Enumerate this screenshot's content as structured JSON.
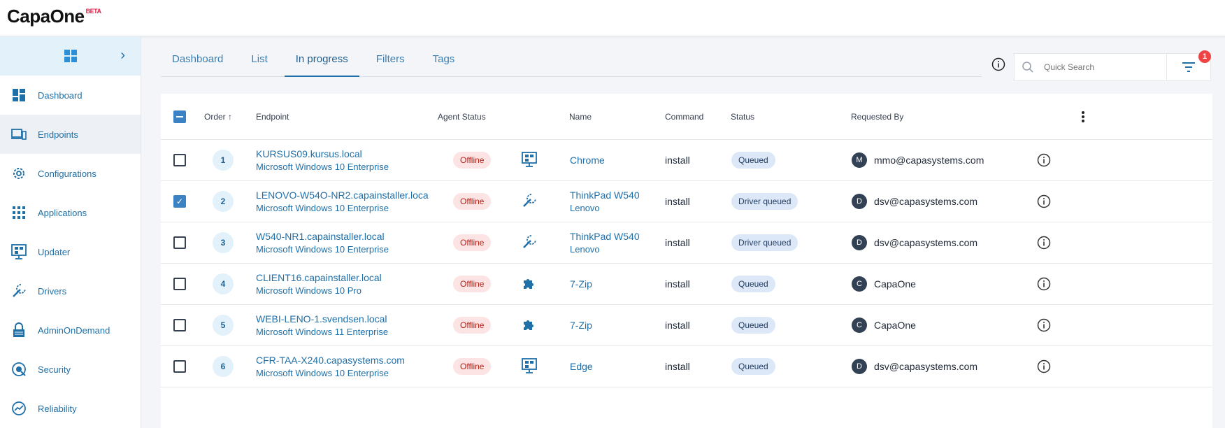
{
  "app": {
    "logo_text": "CapaOne",
    "logo_badge": "BETA"
  },
  "sidebar": {
    "items": [
      {
        "label": "Dashboard",
        "icon": "dashboard-icon"
      },
      {
        "label": "Endpoints",
        "icon": "endpoints-icon"
      },
      {
        "label": "Configurations",
        "icon": "gear-icon"
      },
      {
        "label": "Applications",
        "icon": "apps-grid-icon"
      },
      {
        "label": "Updater",
        "icon": "updater-icon"
      },
      {
        "label": "Drivers",
        "icon": "wrench-icon"
      },
      {
        "label": "AdminOnDemand",
        "icon": "lock-icon"
      },
      {
        "label": "Security",
        "icon": "security-icon"
      },
      {
        "label": "Reliability",
        "icon": "reliability-icon"
      }
    ]
  },
  "tabs": [
    {
      "label": "Dashboard"
    },
    {
      "label": "List"
    },
    {
      "label": "In progress"
    },
    {
      "label": "Filters"
    },
    {
      "label": "Tags"
    }
  ],
  "search": {
    "placeholder": "Quick Search"
  },
  "filter": {
    "badge_count": "1"
  },
  "table": {
    "headers": {
      "order": "Order ↑",
      "endpoint": "Endpoint",
      "agent_status": "Agent Status",
      "name": "Name",
      "command": "Command",
      "status": "Status",
      "requested_by": "Requested By"
    },
    "rows": [
      {
        "checked": false,
        "order": "1",
        "endpoint": "KURSUS09.kursus.local",
        "os": "Microsoft Windows 10 Enterprise",
        "agent_status": "Offline",
        "app_icon": "updater-icon",
        "name": "Chrome",
        "sub": "",
        "command": "install",
        "status": "Queued",
        "avatar": "M",
        "requested_by": "mmo@capasystems.com"
      },
      {
        "checked": true,
        "order": "2",
        "endpoint": "LENOVO-W54O-NR2.capainstaller.loca",
        "os": "Microsoft Windows 10 Enterprise",
        "agent_status": "Offline",
        "app_icon": "wrench-icon",
        "name": "ThinkPad W540",
        "sub": "Lenovo",
        "command": "install",
        "status": "Driver queued",
        "avatar": "D",
        "requested_by": "dsv@capasystems.com"
      },
      {
        "checked": false,
        "order": "3",
        "endpoint": "W540-NR1.capainstaller.local",
        "os": "Microsoft Windows 10 Enterprise",
        "agent_status": "Offline",
        "app_icon": "wrench-icon",
        "name": "ThinkPad W540",
        "sub": "Lenovo",
        "command": "install",
        "status": "Driver queued",
        "avatar": "D",
        "requested_by": "dsv@capasystems.com"
      },
      {
        "checked": false,
        "order": "4",
        "endpoint": "CLIENT16.capainstaller.local",
        "os": "Microsoft Windows 10 Pro",
        "agent_status": "Offline",
        "app_icon": "puzzle-icon",
        "name": "7-Zip",
        "sub": "",
        "command": "install",
        "status": "Queued",
        "avatar": "C",
        "requested_by": "CapaOne"
      },
      {
        "checked": false,
        "order": "5",
        "endpoint": "WEBI-LENO-1.svendsen.local",
        "os": "Microsoft Windows 11 Enterprise",
        "agent_status": "Offline",
        "app_icon": "puzzle-icon",
        "name": "7-Zip",
        "sub": "",
        "command": "install",
        "status": "Queued",
        "avatar": "C",
        "requested_by": "CapaOne"
      },
      {
        "checked": false,
        "order": "6",
        "endpoint": "CFR-TAA-X240.capasystems.com",
        "os": "Microsoft Windows 10 Enterprise",
        "agent_status": "Offline",
        "app_icon": "updater-icon",
        "name": "Edge",
        "sub": "",
        "command": "install",
        "status": "Queued",
        "avatar": "D",
        "requested_by": "dsv@capasystems.com"
      }
    ]
  },
  "colors": {
    "accent": "#1f6fa8",
    "offline_bg": "#fde4e4",
    "queued_bg": "#dce8f8",
    "badge": "#ef4444"
  }
}
